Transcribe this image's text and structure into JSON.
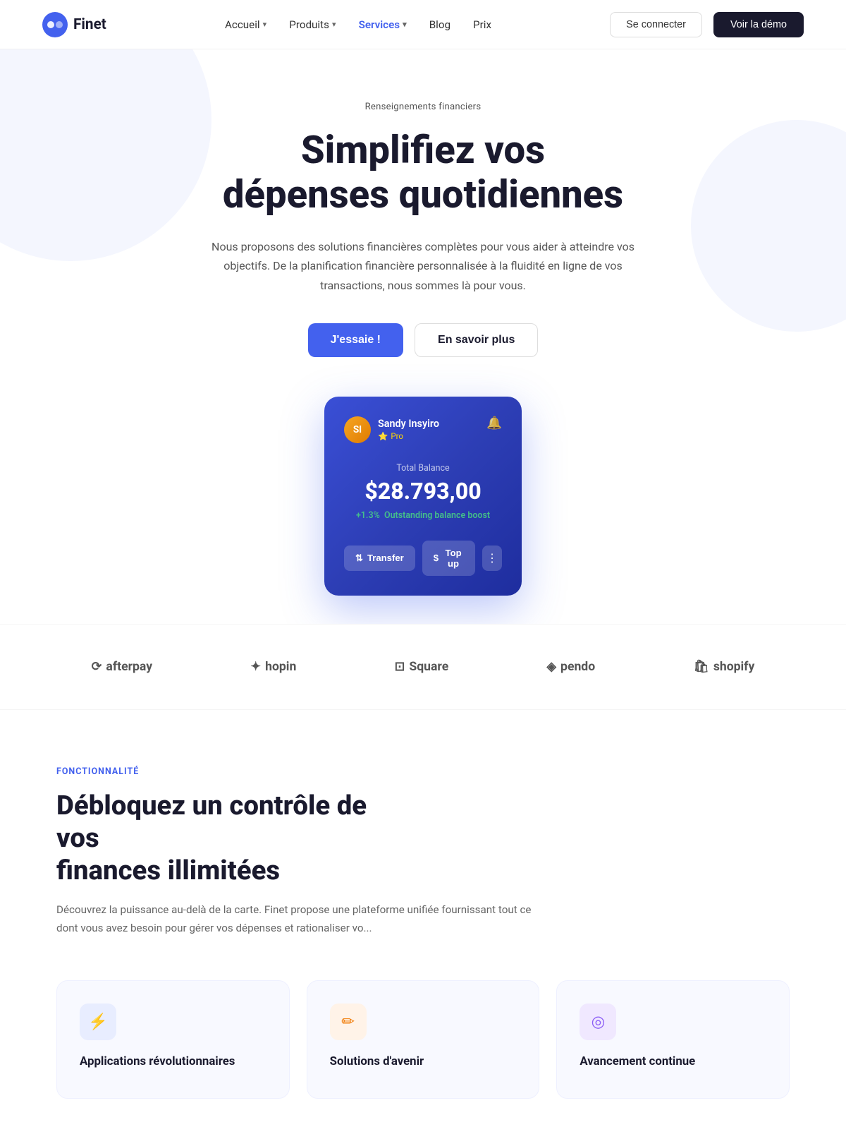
{
  "brand": {
    "name": "Finet",
    "logo_text": "Finet"
  },
  "nav": {
    "links": [
      {
        "label": "Accueil",
        "hasDropdown": true,
        "active": false
      },
      {
        "label": "Produits",
        "hasDropdown": true,
        "active": false
      },
      {
        "label": "Services",
        "hasDropdown": true,
        "active": true
      },
      {
        "label": "Blog",
        "hasDropdown": false,
        "active": false
      },
      {
        "label": "Prix",
        "hasDropdown": false,
        "active": false
      }
    ],
    "btn_connect": "Se connecter",
    "btn_demo": "Voir la démo"
  },
  "hero": {
    "badge": "Renseignements financiers",
    "title_line1": "Simplifiez vos",
    "title_line2": "dépenses quotidiennes",
    "description": "Nous proposons des solutions financières complètes pour vous aider à atteindre vos objectifs. De la planification financière personnalisée à la fluidité en ligne de vos transactions, nous sommes là pour vous.",
    "btn_primary": "J'essaie !",
    "btn_outline": "En savoir plus"
  },
  "dashboard_card": {
    "username": "Sandy Insyiro",
    "badge": "Pro",
    "balance_label": "Total Balance",
    "balance": "$28.793,00",
    "boost_pct": "+1.3%",
    "boost_label": "Outstanding balance boost",
    "btn_transfer": "Transfer",
    "btn_topup": "Top up",
    "avatar_initials": "SI"
  },
  "partners": [
    {
      "name": "afterpay",
      "symbol": "⟳"
    },
    {
      "name": "hopin",
      "symbol": "✦"
    },
    {
      "name": "Square",
      "symbol": "⊡"
    },
    {
      "name": "pendo",
      "symbol": "◈"
    },
    {
      "name": "shopify",
      "symbol": "🛍"
    }
  ],
  "features": {
    "tag": "FONCTIONNALITÉ",
    "title_line1": "Débloquez un contrôle de vos",
    "title_line2": "finances illimitées",
    "description": "Découvrez la puissance au-delà de la carte. Finet propose une plateforme unifiée fournissant tout ce dont vous avez besoin pour gérer vos dépenses et rationaliser vo...",
    "cards": [
      {
        "icon": "⚡",
        "icon_style": "blue",
        "title": "Applications révolutionnaires"
      },
      {
        "icon": "✏",
        "icon_style": "orange",
        "title": "Solutions d'avenir"
      },
      {
        "icon": "◎",
        "icon_style": "purple",
        "title": "Avancement continue"
      }
    ]
  }
}
